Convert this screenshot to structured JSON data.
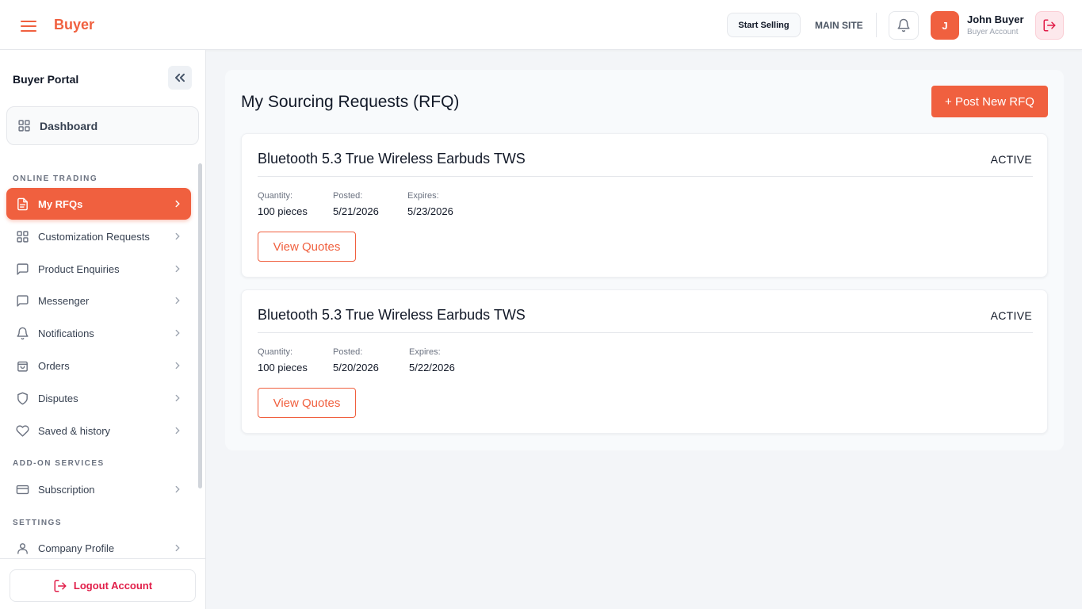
{
  "header": {
    "brand": "Buyer",
    "start_selling": "Start Selling",
    "main_site": "MAIN SITE",
    "user": {
      "initial": "J",
      "name": "John Buyer",
      "role": "Buyer Account"
    }
  },
  "sidebar": {
    "title": "Buyer Portal",
    "dashboard": "Dashboard",
    "sections": {
      "online_trading": "ONLINE TRADING",
      "add_on_services": "ADD-ON SERVICES",
      "settings": "SETTINGS"
    },
    "items": [
      {
        "label": "My RFQs",
        "icon": "document-icon",
        "active": true
      },
      {
        "label": "Customization Requests",
        "icon": "grid-icon"
      },
      {
        "label": "Product Enquiries",
        "icon": "chat-icon"
      },
      {
        "label": "Messenger",
        "icon": "chat-icon"
      },
      {
        "label": "Notifications",
        "icon": "bell-icon"
      },
      {
        "label": "Orders",
        "icon": "bag-icon"
      },
      {
        "label": "Disputes",
        "icon": "shield-icon"
      },
      {
        "label": "Saved & history",
        "icon": "heart-icon"
      },
      {
        "label": "Subscription",
        "icon": "card-icon"
      },
      {
        "label": "Company Profile",
        "icon": "user-icon"
      }
    ],
    "logout": "Logout Account"
  },
  "main": {
    "title": "My Sourcing Requests (RFQ)",
    "post_button": "+ Post New RFQ",
    "labels": {
      "quantity": "Quantity:",
      "posted": "Posted:",
      "expires": "Expires:"
    },
    "rfqs": [
      {
        "title": "Bluetooth 5.3 True Wireless Earbuds TWS",
        "status": "ACTIVE",
        "quantity": "100 pieces",
        "posted": "5/21/2026",
        "expires": "5/23/2026",
        "button": "View Quotes"
      },
      {
        "title": "Bluetooth 5.3 True Wireless Earbuds TWS",
        "status": "ACTIVE",
        "quantity": "100 pieces",
        "posted": "5/20/2026",
        "expires": "5/22/2026",
        "button": "View Quotes"
      }
    ]
  },
  "colors": {
    "accent": "#f0603f",
    "danger": "#e11d48"
  }
}
